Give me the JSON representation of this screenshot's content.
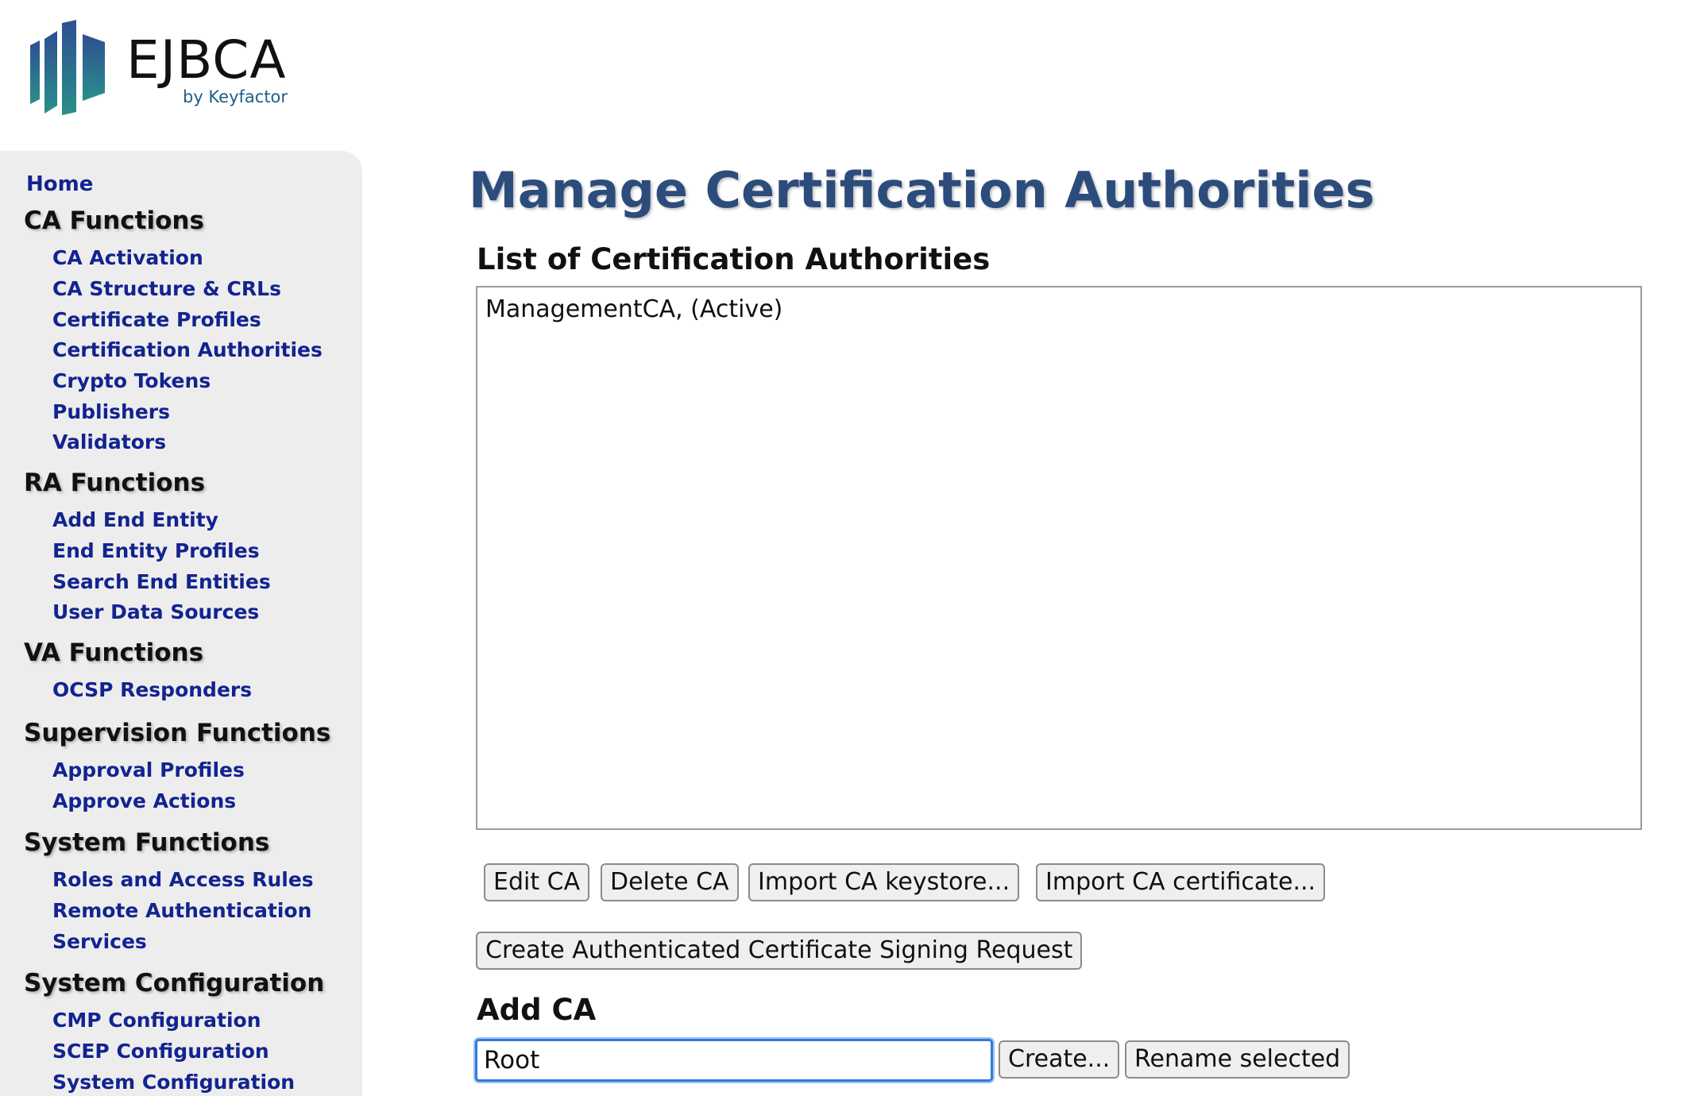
{
  "logo": {
    "name": "EJBCA",
    "tagline": "by Keyfactor"
  },
  "nav": {
    "home": "Home",
    "sections": [
      {
        "heading": "CA Functions",
        "links": [
          "CA Activation",
          "CA Structure & CRLs",
          "Certificate Profiles",
          "Certification Authorities",
          "Crypto Tokens",
          "Publishers",
          "Validators"
        ]
      },
      {
        "heading": "RA Functions",
        "links": [
          "Add End Entity",
          "End Entity Profiles",
          "Search End Entities",
          "User Data Sources"
        ]
      },
      {
        "heading": "VA Functions",
        "links": [
          "OCSP Responders"
        ]
      },
      {
        "heading": "Supervision Functions",
        "links": [
          "Approval Profiles",
          "Approve Actions"
        ]
      },
      {
        "heading": "System Functions",
        "links": [
          "Roles and Access Rules",
          "Remote Authentication",
          "Services"
        ]
      },
      {
        "heading": "System Configuration",
        "links": [
          "CMP Configuration",
          "SCEP Configuration",
          "System Configuration"
        ]
      }
    ]
  },
  "main": {
    "title": "Manage Certification Authorities",
    "list_heading": "List of Certification Authorities",
    "ca_items": [
      "ManagementCA, (Active)"
    ],
    "buttons": {
      "edit_ca": "Edit CA",
      "delete_ca": "Delete CA",
      "import_keystore": "Import CA keystore...",
      "import_certificate": "Import CA certificate...",
      "create_csr": "Create Authenticated Certificate Signing Request"
    },
    "add_ca_heading": "Add CA",
    "add_ca_input_value": "Root",
    "create_button": "Create...",
    "rename_button": "Rename selected"
  },
  "colors": {
    "link": "#13238f",
    "title": "#2c4c7c",
    "sidebar_bg": "#ededed",
    "focus": "#2f7bdc"
  }
}
